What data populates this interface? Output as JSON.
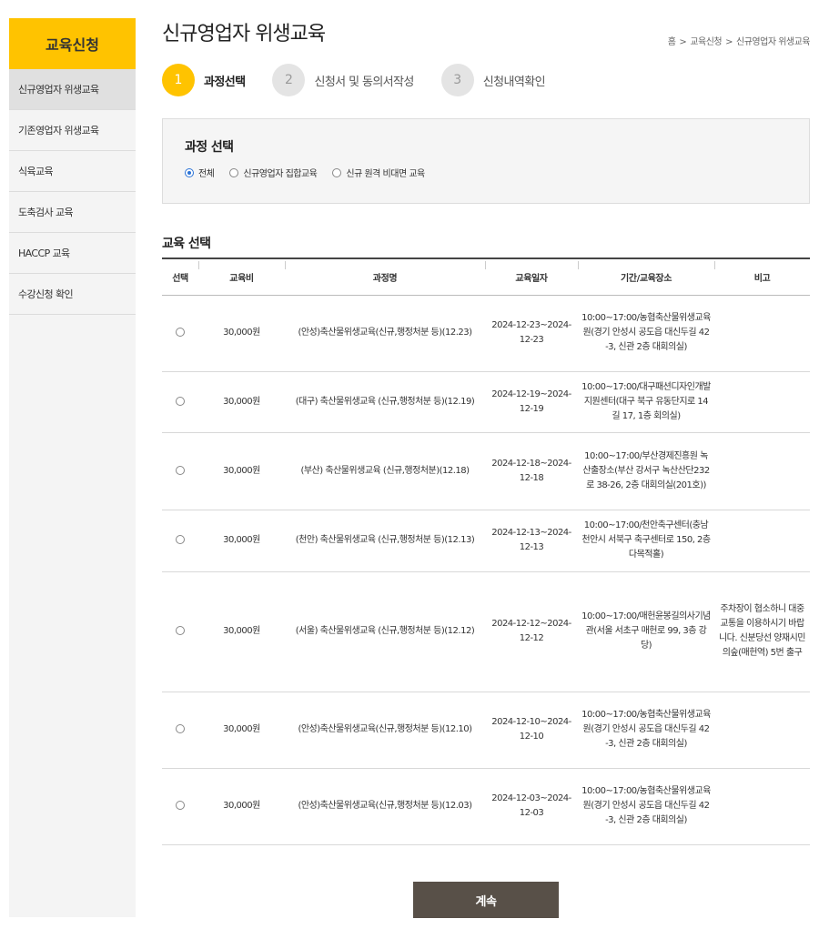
{
  "sidebar": {
    "title": "교육신청",
    "items": [
      {
        "label": "신규영업자 위생교육",
        "active": true
      },
      {
        "label": "기존영업자 위생교육",
        "active": false
      },
      {
        "label": "식육교육",
        "active": false
      },
      {
        "label": "도축검사 교육",
        "active": false
      },
      {
        "label": "HACCP 교육",
        "active": false
      },
      {
        "label": "수강신청 확인",
        "active": false
      }
    ]
  },
  "header": {
    "title": "신규영업자 위생교육",
    "breadcrumb": [
      "홈",
      "교육신청",
      "신규영업자 위생교육"
    ]
  },
  "steps": [
    {
      "num": "1",
      "label": "과정선택",
      "active": true
    },
    {
      "num": "2",
      "label": "신청서 및 동의서작성",
      "active": false
    },
    {
      "num": "3",
      "label": "신청내역확인",
      "active": false
    }
  ],
  "course_select": {
    "title": "과정 선택",
    "options": [
      {
        "label": "전체",
        "checked": true
      },
      {
        "label": "신규영업자 집합교육",
        "checked": false
      },
      {
        "label": "신규 원격 비대면 교육",
        "checked": false
      }
    ]
  },
  "edu_select": {
    "title": "교육 선택",
    "columns": [
      "선택",
      "교육비",
      "과정명",
      "교육일자",
      "기간/교육장소",
      "비고"
    ],
    "rows": [
      {
        "fee": "30,000원",
        "course": "(안성)축산물위생교육(신규,행정처분 등)(12.23)",
        "date": "2024-12-23~2024-12-23",
        "place": "10:00~17:00/농협축산물위생교육원(경기 안성시 공도읍 대신두길 42-3, 신관 2층 대회의실)",
        "note": ""
      },
      {
        "fee": "30,000원",
        "course": "(대구) 축산물위생교육 (신규,행정처분 등)(12.19)",
        "date": "2024-12-19~2024-12-19",
        "place": "10:00~17:00/대구패션디자인개발지원센터(대구 북구 유동단지로 14길 17, 1층 회의실)",
        "note": ""
      },
      {
        "fee": "30,000원",
        "course": "(부산) 축산물위생교육 (신규,행정처분)(12.18)",
        "date": "2024-12-18~2024-12-18",
        "place": "10:00~17:00/부산경제진흥원 녹산출장소(부산 강서구 녹산산단232로 38-26, 2층 대회의실(201호))",
        "note": ""
      },
      {
        "fee": "30,000원",
        "course": "(천안) 축산물위생교육 (신규,행정처분 등)(12.13)",
        "date": "2024-12-13~2024-12-13",
        "place": "10:00~17:00/천안축구센터(충남 천안시 서북구 축구센터로 150, 2층 다목적홀)",
        "note": ""
      },
      {
        "fee": "30,000원",
        "course": "(서울) 축산물위생교육 (신규,행정처분 등)(12.12)",
        "date": "2024-12-12~2024-12-12",
        "place": "10:00~17:00/매헌윤봉길의사기념관(서울 서초구 매헌로 99, 3층 강당)",
        "note": "주차장이 협소하니 대중교통을 이용하시기 바랍니다. 신분당선 양재시민의숲(매헌역) 5번 출구"
      },
      {
        "fee": "30,000원",
        "course": "(안성)축산물위생교육(신규,행정처분 등)(12.10)",
        "date": "2024-12-10~2024-12-10",
        "place": "10:00~17:00/농협축산물위생교육원(경기 안성시 공도읍 대신두길 42-3, 신관 2층 대회의실)",
        "note": ""
      },
      {
        "fee": "30,000원",
        "course": "(안성)축산물위생교육(신규,행정처분 등)(12.03)",
        "date": "2024-12-03~2024-12-03",
        "place": "10:00~17:00/농협축산물위생교육원(경기 안성시 공도읍 대신두길 42-3, 신관 2층 대회의실)",
        "note": ""
      }
    ]
  },
  "continue_label": "계속",
  "colors": {
    "accent": "#ffc300",
    "button": "#585048",
    "radio": "#2b73d6"
  }
}
